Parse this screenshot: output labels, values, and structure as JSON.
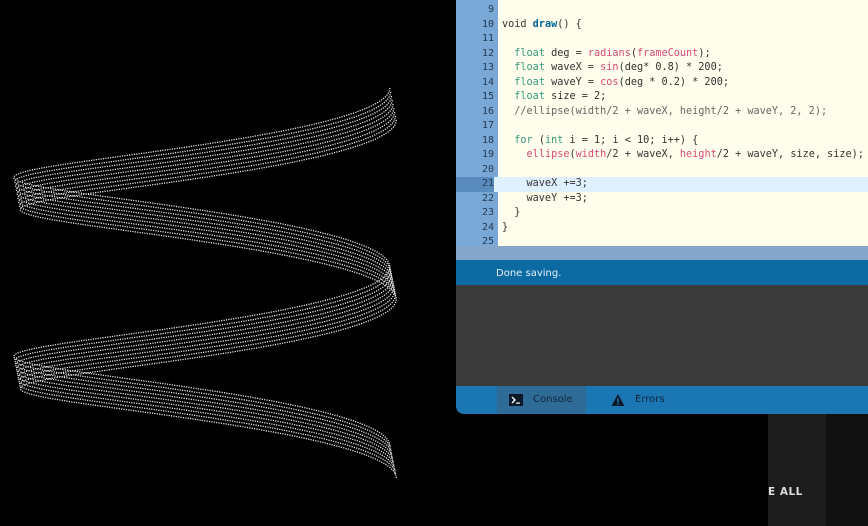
{
  "code_lines": [
    {
      "n": "9",
      "html": ""
    },
    {
      "n": "10",
      "html": "void <span class='fn'>draw</span>() {"
    },
    {
      "n": "11",
      "html": ""
    },
    {
      "n": "12",
      "html": "  <span class='kw'>float</span> deg = <span class='bi'>radians</span>(<span class='bi'>frameCount</span>);"
    },
    {
      "n": "13",
      "html": "  <span class='kw'>float</span> waveX = <span class='bi'>sin</span>(deg* 0.8) * 200;"
    },
    {
      "n": "14",
      "html": "  <span class='kw'>float</span> waveY = <span class='bi'>cos</span>(deg * 0.2) * 200;"
    },
    {
      "n": "15",
      "html": "  <span class='kw'>float</span> size = 2;"
    },
    {
      "n": "16",
      "html": "  <span class='cm'>//ellipse(width/2 + waveX, height/2 + waveY, 2, 2);</span>"
    },
    {
      "n": "17",
      "html": ""
    },
    {
      "n": "18",
      "html": "  <span class='kw'>for</span> (<span class='kw'>int</span> i = 1; i &lt; 10; i++) {"
    },
    {
      "n": "19",
      "html": "    <span class='bi'>ellipse</span>(<span class='bi'>width</span>/2 + waveX, <span class='bi'>height</span>/2 + waveY, size, size);"
    },
    {
      "n": "20",
      "html": ""
    },
    {
      "n": "21",
      "html": "    waveX +=3;"
    },
    {
      "n": "22",
      "html": "    waveY +=3;"
    },
    {
      "n": "23",
      "html": "  }"
    },
    {
      "n": "24",
      "html": "}"
    },
    {
      "n": "25",
      "html": ""
    }
  ],
  "active_line": "21",
  "status": {
    "message": "Done saving."
  },
  "tabs": {
    "console": "Console",
    "errors": "Errors"
  },
  "overlay": {
    "button_fragment": "E ALL"
  },
  "icons": {
    "console": "terminal-icon",
    "errors": "warning-icon"
  },
  "colors": {
    "status_bar": "#0a6aa1",
    "tab_bar": "#1b77b4",
    "gutter": "#7aa8d6",
    "editor_bg": "#fffdeb"
  }
}
